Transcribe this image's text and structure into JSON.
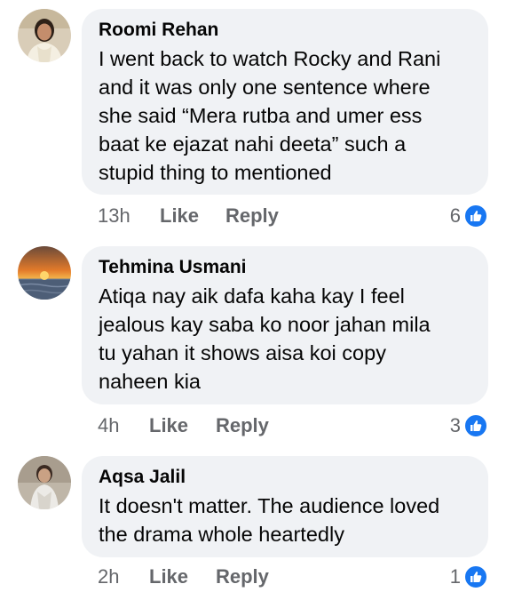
{
  "colors": {
    "bubble_background": "#f0f2f5",
    "meta_text": "#65676b",
    "like_blue": "#1877f2"
  },
  "comments": [
    {
      "author": "Roomi Rehan",
      "avatar_icon": "woman-avatar-photo",
      "text": "I went back to watch Rocky and Rani\nand it was only one sentence where\nshe said “Mera rutba and umer ess\nbaat ke ejazat nahi deeta” such a\nstupid thing to mentioned",
      "time": "13h",
      "like_label": "Like",
      "reply_label": "Reply",
      "reaction_count": "6",
      "reaction_icon": "thumbs-up-icon"
    },
    {
      "author": "Tehmina Usmani",
      "avatar_icon": "sunset-avatar-photo",
      "text": "Atiqa nay aik dafa kaha kay I feel\njealous kay saba ko noor jahan mila\ntu yahan it shows aisa koi copy\nnaheen kia",
      "time": "4h",
      "like_label": "Like",
      "reply_label": "Reply",
      "reaction_count": "3",
      "reaction_icon": "thumbs-up-icon"
    },
    {
      "author": "Aqsa Jalil",
      "avatar_icon": "girl-avatar-photo",
      "text": "It doesn't matter. The audience loved\nthe drama whole heartedly",
      "time": "2h",
      "like_label": "Like",
      "reply_label": "Reply",
      "reaction_count": "1",
      "reaction_icon": "thumbs-up-icon"
    }
  ]
}
